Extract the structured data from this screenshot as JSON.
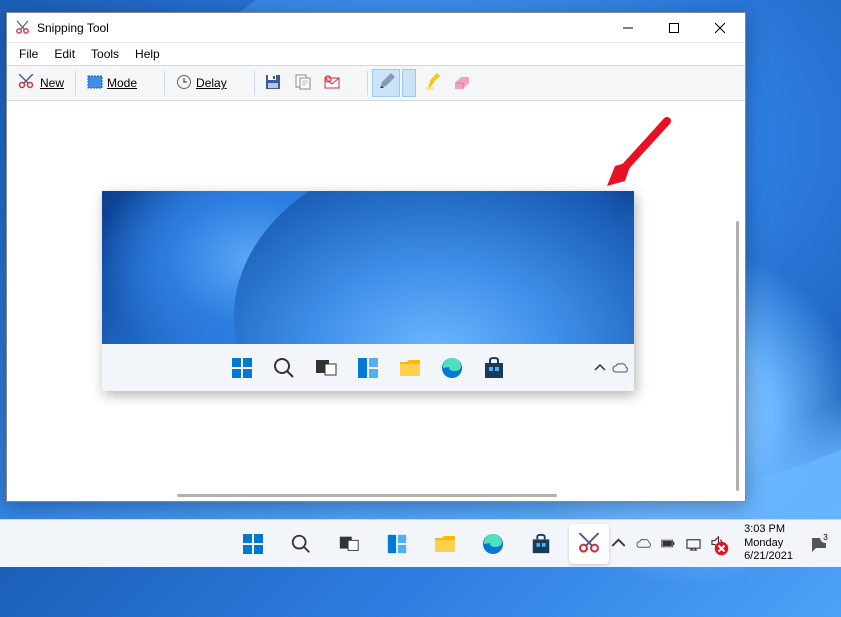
{
  "window": {
    "title": "Snipping Tool"
  },
  "menubar": {
    "file": "File",
    "edit": "Edit",
    "tools": "Tools",
    "help": "Help"
  },
  "toolbar": {
    "new_label": "New",
    "mode_label": "Mode",
    "delay_label": "Delay"
  },
  "icons": {
    "snipping": "snipping-tool-icon",
    "new": "scissors-new-icon",
    "mode": "rectangle-mode-icon",
    "delay": "clock-icon",
    "save": "floppy-icon",
    "copy": "copy-icon",
    "send": "envelope-icon",
    "pen": "pen-icon",
    "highlighter": "highlighter-icon",
    "eraser": "eraser-icon"
  },
  "captured_taskbar_apps": [
    "start",
    "search",
    "task-view",
    "widgets",
    "file-explorer",
    "edge",
    "microsoft-store"
  ],
  "outer_taskbar_apps": [
    "start",
    "search",
    "task-view",
    "widgets",
    "file-explorer",
    "edge",
    "microsoft-store",
    "snipping-tool"
  ],
  "systray": {
    "time": "3:03 PM",
    "day": "Monday",
    "date": "6/21/2021",
    "notif_count": "3"
  }
}
